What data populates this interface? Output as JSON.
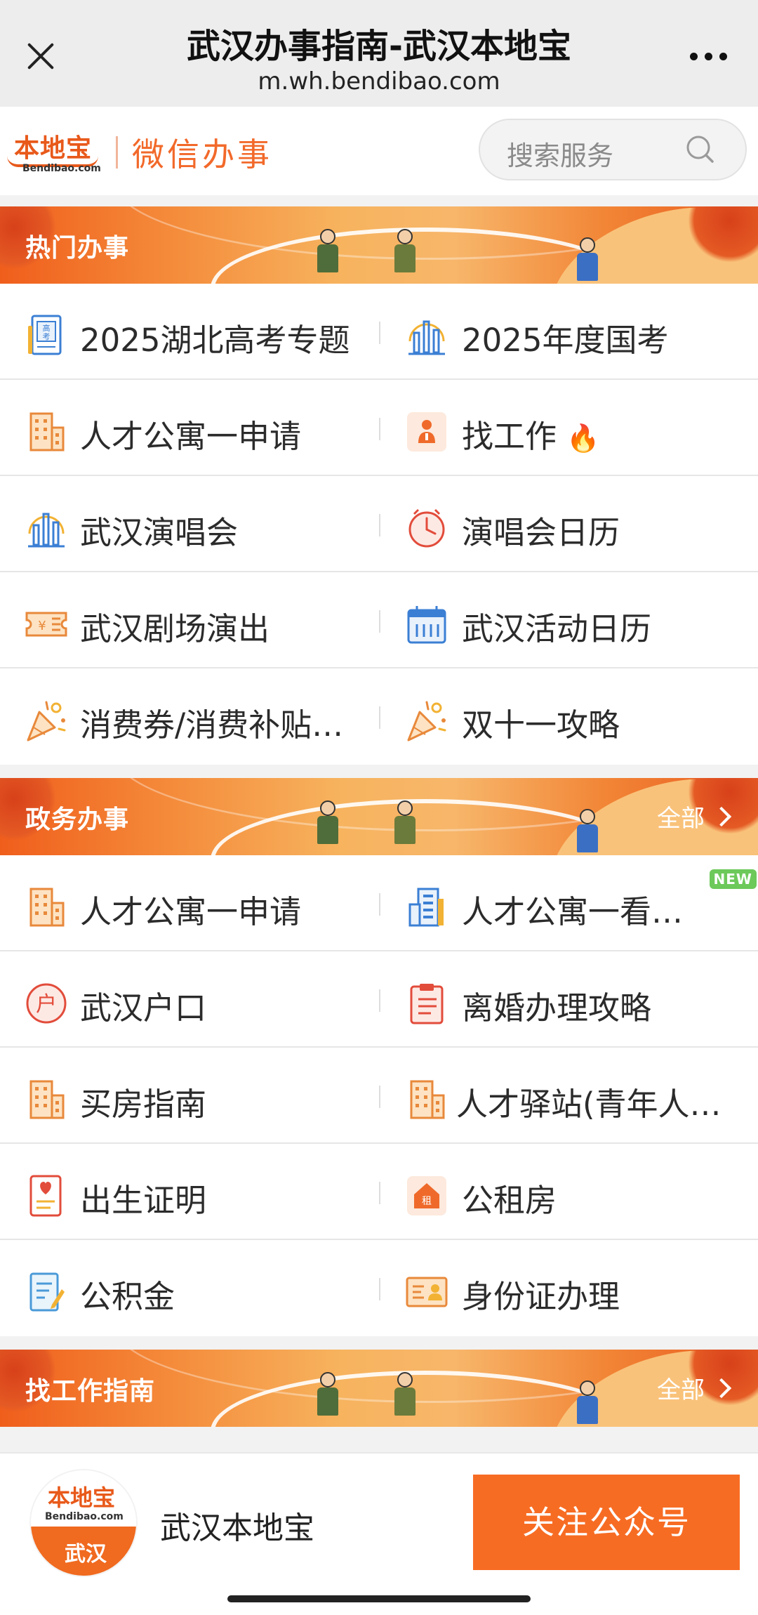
{
  "window": {
    "title": "武汉办事指南-武汉本地宝",
    "url": "m.wh.bendibao.com"
  },
  "header": {
    "logo_text": "本地宝",
    "logo_sub": "Bendibao.com",
    "name": "微信办事",
    "search_placeholder": "搜索服务"
  },
  "sections": {
    "hot": {
      "title": "热门办事",
      "items": [
        {
          "label": "2025湖北高考专题",
          "icon": "exam-icon"
        },
        {
          "label": "2025年度国考",
          "icon": "bar-chart-icon"
        },
        {
          "label": "人才公寓一申请",
          "icon": "building-icon"
        },
        {
          "label": "找工作",
          "icon": "person-badge-icon",
          "hot": "🔥"
        },
        {
          "label": "武汉演唱会",
          "icon": "bar-chart-icon"
        },
        {
          "label": "演唱会日历",
          "icon": "clock-icon"
        },
        {
          "label": "武汉剧场演出",
          "icon": "ticket-icon"
        },
        {
          "label": "武汉活动日历",
          "icon": "calendar-icon"
        },
        {
          "label": "消费券/消费补贴…",
          "icon": "party-popper-icon"
        },
        {
          "label": "双十一攻略",
          "icon": "party-popper-icon"
        }
      ]
    },
    "gov": {
      "title": "政务办事",
      "more": "全部",
      "new_badge": "NEW",
      "items": [
        {
          "label": "人才公寓一申请",
          "icon": "building-icon"
        },
        {
          "label": "人才公寓一看…",
          "icon": "office-building-icon"
        },
        {
          "label": "武汉户口",
          "icon": "hukou-icon"
        },
        {
          "label": "离婚办理攻略",
          "icon": "clipboard-icon"
        },
        {
          "label": "买房指南",
          "icon": "building-icon"
        },
        {
          "label": "人才驿站(青年人…",
          "icon": "building-icon"
        },
        {
          "label": "出生证明",
          "icon": "certificate-icon"
        },
        {
          "label": "公租房",
          "icon": "rent-house-icon"
        },
        {
          "label": "公积金",
          "icon": "document-edit-icon"
        },
        {
          "label": "身份证办理",
          "icon": "id-card-icon"
        }
      ]
    },
    "jobs": {
      "title": "找工作指南",
      "more": "全部"
    }
  },
  "bottom_bar": {
    "logo_top": "本地宝",
    "logo_sub": "Bendibao.com",
    "logo_city": "武汉",
    "name": "武汉本地宝",
    "follow_button": "关注公众号"
  },
  "colors": {
    "accent": "#f76c23",
    "brand_orange": "#e8591a",
    "new_badge": "#6dc95a"
  }
}
